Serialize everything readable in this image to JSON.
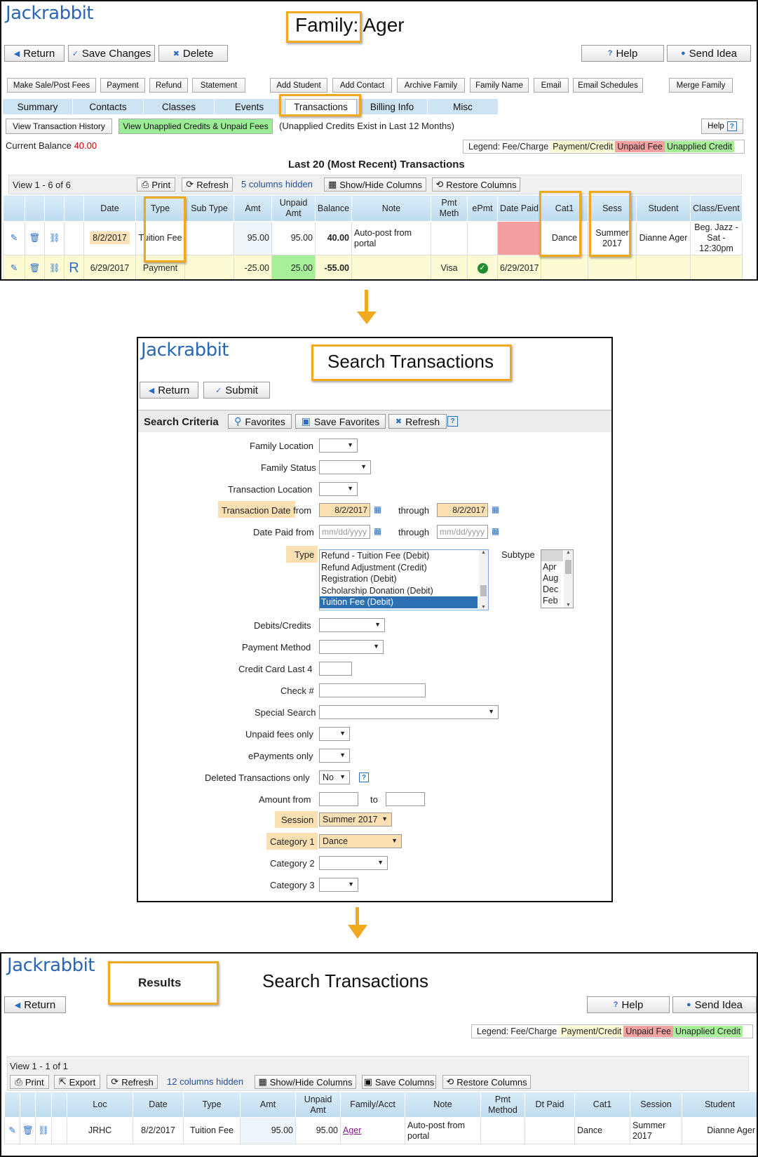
{
  "brand": "Jackrabbit",
  "colors": {
    "accent": "#2a67b8",
    "highlight": "#f0a91e",
    "unpaid": "#f4a0a0",
    "unapplied": "#a8ef9a",
    "payment": "#fdfbd4"
  },
  "family": {
    "title": "Family: Ager",
    "buttons": {
      "return": "Return",
      "save": "Save Changes",
      "delete": "Delete",
      "help": "Help",
      "send_idea": "Send Idea"
    },
    "actions": [
      "Make Sale/Post Fees",
      "Payment",
      "Refund",
      "Statement",
      "Add Student",
      "Add Contact",
      "Archive Family",
      "Family Name",
      "Email",
      "Email Schedules",
      "Merge Family"
    ],
    "tabs": [
      "Summary",
      "Contacts",
      "Classes",
      "Events",
      "Transactions",
      "Billing Info",
      "Misc"
    ],
    "active_tab": "Transactions",
    "view_history": "View Transaction History",
    "view_unapplied": "View Unapplied Credits & Unpaid Fees",
    "unapplied_note": "(Unapplied Credits Exist in Last 12 Months)",
    "help": "Help",
    "balance_label": "Current Balance",
    "balance_value": "40.00",
    "legend": {
      "label": "Legend:",
      "fee": "Fee/Charge",
      "payment": "Payment/Credit",
      "unpaid": "Unpaid Fee",
      "unapplied": "Unapplied Credit"
    },
    "grid_title": "Last 20 (Most Recent) Transactions",
    "toolbar": {
      "view": "View 1 - 6 of 6",
      "print": "Print",
      "refresh": "Refresh",
      "hidden": "5 columns hidden",
      "showhide": "Show/Hide Columns",
      "restore": "Restore Columns"
    },
    "columns": [
      "Date",
      "Type",
      "Sub Type",
      "Amt",
      "Unpaid Amt",
      "Balance",
      "Note",
      "Pmt Meth",
      "ePmt",
      "Date Paid",
      "Cat1",
      "Sess",
      "Student",
      "Class/Event"
    ],
    "rows": [
      {
        "date": "8/2/2017",
        "type": "Tuition Fee",
        "subtype": "",
        "amt": "95.00",
        "unpaid": "95.00",
        "balance": "40.00",
        "note": "Auto-post from portal",
        "pmt": "",
        "epmt": "",
        "datepaid": "",
        "cat1": "Dance",
        "sess": "Summer 2017",
        "student": "Dianne Ager",
        "class": "Beg. Jazz - Sat - 12:30pm"
      },
      {
        "r": "R",
        "date": "6/29/2017",
        "type": "Payment",
        "subtype": "",
        "amt": "-25.00",
        "unpaid": "25.00",
        "balance": "-55.00",
        "note": "",
        "pmt": "Visa",
        "epmt": "check",
        "datepaid": "6/29/2017",
        "cat1": "",
        "sess": "",
        "student": "",
        "class": ""
      }
    ]
  },
  "search": {
    "title": "Search Transactions",
    "buttons": {
      "return": "Return",
      "submit": "Submit"
    },
    "criteria_label": "Search Criteria",
    "favorites": "Favorites",
    "save_favorites": "Save Favorites",
    "refresh": "Refresh",
    "fields": {
      "family_location": "Family Location",
      "family_status": "Family Status",
      "transaction_location": "Transaction Location",
      "transaction_date": "Transaction Date",
      "from": "from",
      "through": "through",
      "date_from_value": "8/2/2017",
      "date_through_value": "8/2/2017",
      "date_paid": "Date Paid",
      "date_placeholder": "mm/dd/yyyy",
      "type": "Type",
      "type_options": [
        "Refund - Tuition Fee (Debit)",
        "Refund Adjustment (Credit)",
        "Registration (Debit)",
        "Scholarship Donation (Debit)",
        "Tuition Fee (Debit)"
      ],
      "type_selected": "Tuition Fee (Debit)",
      "subtype": "Subtype",
      "subtype_options": [
        "",
        "Apr",
        "Aug",
        "Dec",
        "Feb"
      ],
      "debits_credits": "Debits/Credits",
      "payment_method": "Payment Method",
      "cc_last4": "Credit Card Last 4",
      "check_no": "Check #",
      "special_search": "Special Search",
      "unpaid_only": "Unpaid fees only",
      "epayments_only": "ePayments only",
      "deleted_only": "Deleted Transactions only",
      "deleted_value": "No",
      "amount_from": "Amount from",
      "to": "to",
      "session": "Session",
      "session_value": "Summer 2017",
      "category1": "Category 1",
      "category1_value": "Dance",
      "category2": "Category 2",
      "category3": "Category 3"
    }
  },
  "results": {
    "callout": "Results",
    "title": "Search Transactions",
    "buttons": {
      "return": "Return",
      "help": "Help",
      "send_idea": "Send Idea"
    },
    "legend": {
      "label": "Legend:",
      "fee": "Fee/Charge",
      "payment": "Payment/Credit",
      "unpaid": "Unpaid Fee",
      "unapplied": "Unapplied Credit"
    },
    "toolbar": {
      "view": "View 1 - 1 of 1",
      "print": "Print",
      "export": "Export",
      "refresh": "Refresh",
      "hidden": "12 columns hidden",
      "showhide": "Show/Hide Columns",
      "save": "Save Columns",
      "restore": "Restore Columns"
    },
    "columns": [
      "Loc",
      "Date",
      "Type",
      "Amt",
      "Unpaid Amt",
      "Family/Acct",
      "Note",
      "Pmt Method",
      "Dt Paid",
      "Cat1",
      "Session",
      "Student"
    ],
    "row": {
      "loc": "JRHC",
      "date": "8/2/2017",
      "type": "Tuition Fee",
      "amt": "95.00",
      "unpaid": "95.00",
      "family": "Ager",
      "note": "Auto-post from portal",
      "pmt": "",
      "dtpaid": "",
      "cat1": "Dance",
      "session": "Summer 2017",
      "student": "Dianne Ager"
    }
  }
}
